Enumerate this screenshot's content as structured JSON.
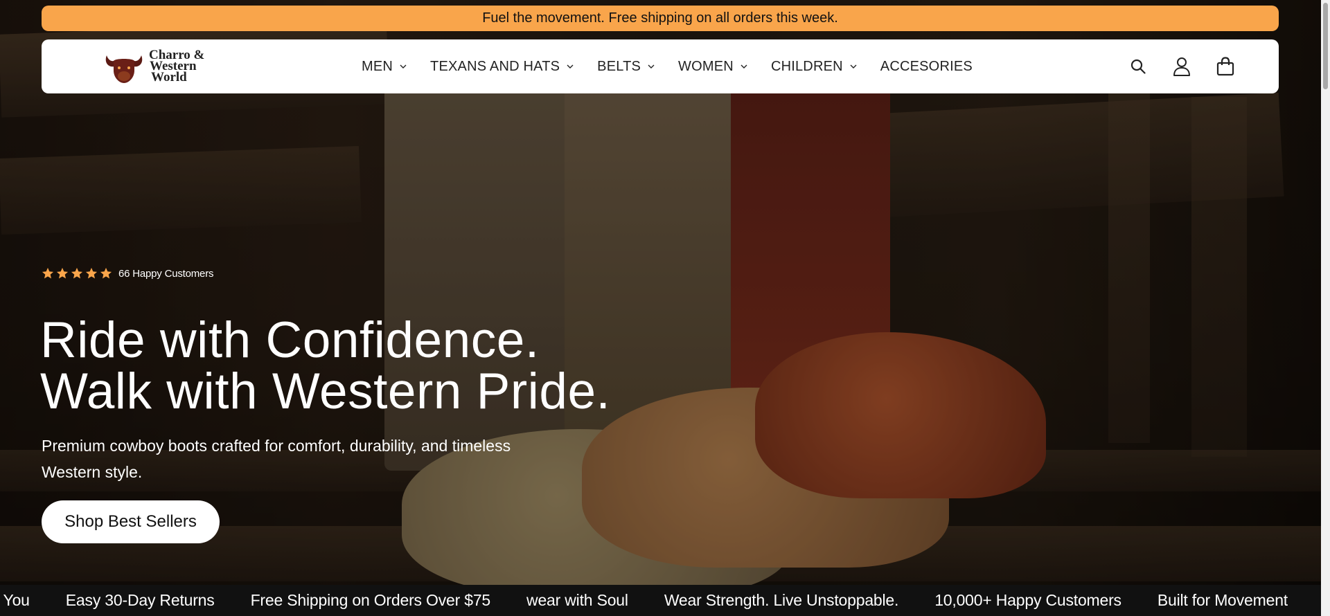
{
  "announcement": {
    "text": "Fuel the movement. Free shipping on all orders this week."
  },
  "brand": {
    "line1": "Charro &",
    "line2": "Western",
    "line3": "World"
  },
  "nav": [
    {
      "label": "MEN",
      "dropdown": true
    },
    {
      "label": "TEXANS AND HATS",
      "dropdown": true
    },
    {
      "label": "BELTS",
      "dropdown": true
    },
    {
      "label": "WOMEN",
      "dropdown": true
    },
    {
      "label": "CHILDREN",
      "dropdown": true
    },
    {
      "label": "ACCESORIES",
      "dropdown": false
    }
  ],
  "header_icons": [
    "search-icon",
    "account-icon",
    "cart-icon"
  ],
  "hero": {
    "rating": {
      "stars": 5,
      "text": "66 Happy Customers"
    },
    "headline_line1": "Ride with Confidence.",
    "headline_line2": "Walk with Western Pride.",
    "subtext": "Premium cowboy boots crafted for comfort, durability, and timeless Western style.",
    "cta": "Shop Best Sellers"
  },
  "marquee": [
    "th You",
    "Easy 30-Day Returns",
    "Free Shipping on Orders Over $75",
    "wear with Soul",
    "Wear Strength. Live Unstoppable.",
    "10,000+ Happy Customers",
    "Built for Movement"
  ],
  "colors": {
    "announcement_bg": "#f9a54b",
    "star": "#f9a54b",
    "header_bg": "#ffffff",
    "text_dark": "#222222",
    "marquee_bg": "#111111"
  }
}
